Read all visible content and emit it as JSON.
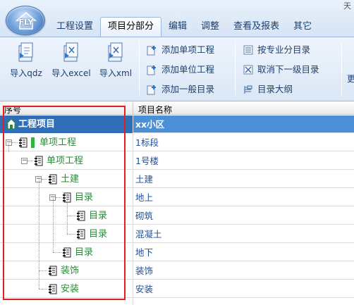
{
  "app": {
    "logo_text": "FLY",
    "corner_text": "天"
  },
  "tabs": [
    {
      "label": "工程设置",
      "active": false
    },
    {
      "label": "项目分部分",
      "active": true
    },
    {
      "label": "编辑",
      "active": false
    },
    {
      "label": "调整",
      "active": false
    },
    {
      "label": "查看及报表",
      "active": false
    },
    {
      "label": "其它",
      "active": false
    }
  ],
  "ribbon": {
    "import_buttons": [
      {
        "label": "导入qdz",
        "icon": "import-qdz-icon"
      },
      {
        "label": "导入excel",
        "icon": "import-excel-icon"
      },
      {
        "label": "导入xml",
        "icon": "import-xml-icon"
      }
    ],
    "add_buttons": [
      {
        "label": "添加单项工程",
        "icon": "add-plus-icon"
      },
      {
        "label": "添加单位工程",
        "icon": "add-plus-icon"
      },
      {
        "label": "添加一般目录",
        "icon": "add-plus-icon"
      }
    ],
    "catalog_buttons": [
      {
        "label": "按专业分目录",
        "icon": "list-icon"
      },
      {
        "label": "取消下一级目录",
        "icon": "cancel-box-icon"
      },
      {
        "label": "目录大纲",
        "icon": "outline-icon"
      }
    ],
    "overflow_label": "更"
  },
  "grid": {
    "headers": {
      "seq": "序号",
      "name": "项目名称"
    },
    "rows": [
      {
        "label": "工程项目",
        "name": "xx小区",
        "level": 0,
        "icon": "home-icon",
        "selected": true
      },
      {
        "label": "单项工程",
        "name": "1标段",
        "level": 1,
        "icon": "node-icon",
        "selected": false
      },
      {
        "label": "单项工程",
        "name": "1号楼",
        "level": 2,
        "icon": "node-icon",
        "selected": false
      },
      {
        "label": "土建",
        "name": "土建",
        "level": 3,
        "icon": "node-icon",
        "selected": false
      },
      {
        "label": "目录",
        "name": "地上",
        "level": 4,
        "icon": "node-icon",
        "selected": false
      },
      {
        "label": "目录",
        "name": "砌筑",
        "level": 5,
        "icon": "node-icon",
        "selected": false
      },
      {
        "label": "目录",
        "name": "混凝土",
        "level": 5,
        "icon": "node-icon",
        "selected": false
      },
      {
        "label": "目录",
        "name": "地下",
        "level": 4,
        "icon": "node-icon",
        "selected": false
      },
      {
        "label": "装饰",
        "name": "装饰",
        "level": 3,
        "icon": "node-icon",
        "selected": false
      },
      {
        "label": "安装",
        "name": "安装",
        "level": 3,
        "icon": "node-icon",
        "selected": false
      }
    ]
  },
  "colors": {
    "selection": "#4a8fd8",
    "tree_text": "#2a8a3a",
    "name_text": "#1f4f9a",
    "highlight_box": "#e02020"
  }
}
